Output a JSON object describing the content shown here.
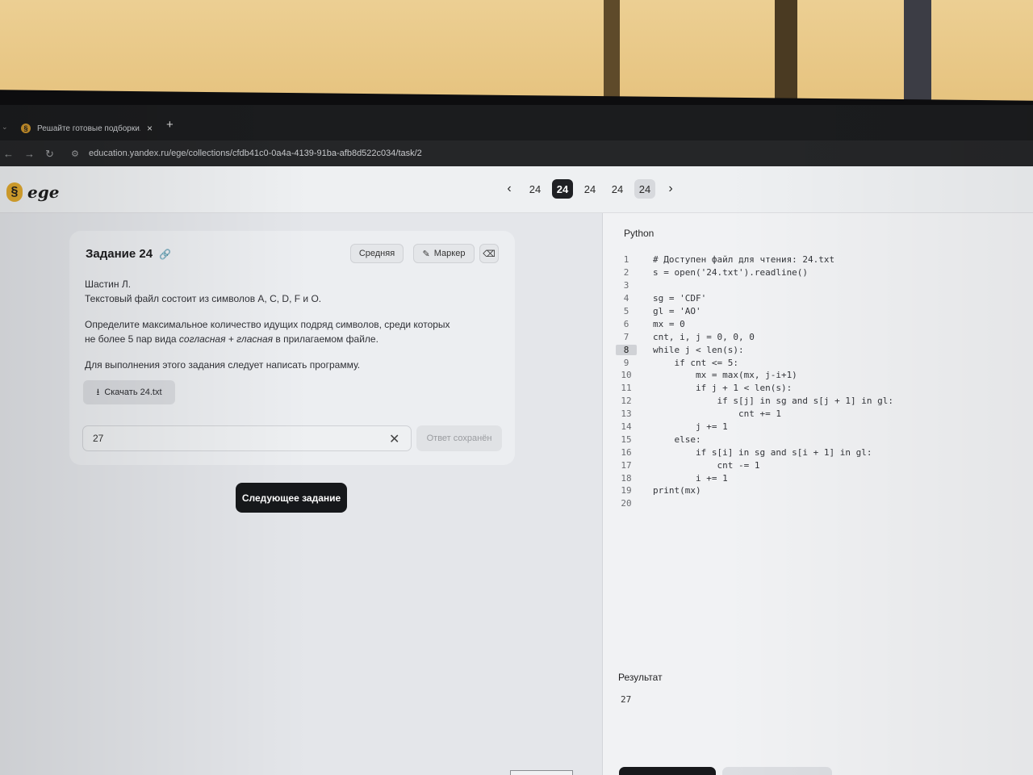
{
  "browser": {
    "tab_title": "Решайте готовые подборки. Ш",
    "tab_close": "×",
    "new_tab": "+",
    "url": "education.yandex.ru/ege/collections/cfdb41c0-0a4a-4139-91ba-afb8d522c034/task/2"
  },
  "header": {
    "logo_text": "ege",
    "pager": {
      "prev": "‹",
      "next": "›",
      "items": [
        "24",
        "24",
        "24",
        "24",
        "24"
      ]
    }
  },
  "task": {
    "title": "Задание 24",
    "level": "Средняя",
    "marker": "Маркер",
    "author": "Шастин Л.",
    "line1": "Текстовый файл состоит из символов A, C, D, F и O.",
    "desc_part1": "Определите максимальное количество идущих подряд символов, среди которых",
    "desc_part2a": "не более 5 пар вида ",
    "desc_italic": "согласная + гласная",
    "desc_part2b": " в прилагаемом файле.",
    "instruction": "Для выполнения этого задания следует написать программу.",
    "download_label": "Скачать 24.txt",
    "answer_value": "27",
    "saved_label": "Ответ сохранён",
    "next_label": "Следующее задание"
  },
  "editor": {
    "language": "Python",
    "current_line": 8,
    "lines": [
      "# Доступен файл для чтения: 24.txt",
      "s = open('24.txt').readline()",
      "",
      "sg = 'CDF'",
      "gl = 'AO'",
      "mx = 0",
      "cnt, i, j = 0, 0, 0",
      "while j < len(s):",
      "    if cnt <= 5:",
      "        mx = max(mx, j-i+1)",
      "        if j + 1 < len(s):",
      "            if s[j] in sg and s[j + 1] in gl:",
      "                cnt += 1",
      "        j += 1",
      "    else:",
      "        if s[i] in sg and s[i + 1] in gl:",
      "            cnt -= 1",
      "        i += 1",
      "print(mx)",
      ""
    ],
    "result_label": "Результат",
    "result_value": "27"
  },
  "colors": {
    "accent_dark": "#16181b",
    "logo_gold": "#e0a92f",
    "wall": "#e8c98a"
  },
  "icons": {
    "tab_favicon": "yandex-education-icon",
    "link": "link-icon",
    "marker": "pencil-icon",
    "eraser": "eraser-icon",
    "download": "download-icon",
    "clear": "close-icon"
  }
}
